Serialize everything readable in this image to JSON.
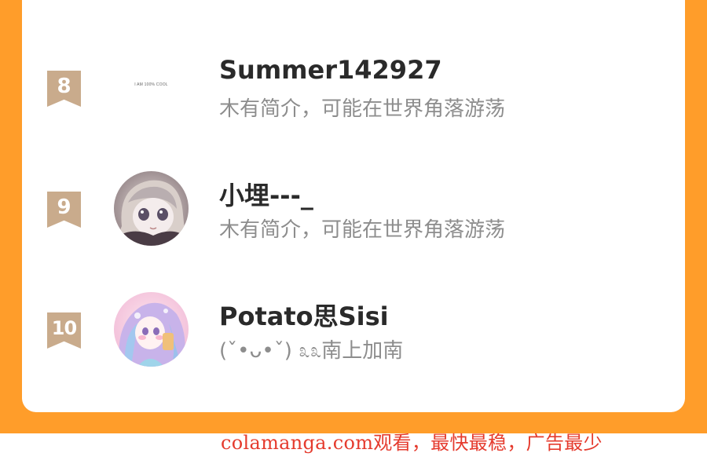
{
  "ranking": {
    "entries": [
      {
        "rank": "8",
        "username": "Summer142927",
        "bio": "木有简介，可能在世界角落游荡",
        "avatar_text": "I AM 100% COOL"
      },
      {
        "rank": "9",
        "username": "小埋---_",
        "bio": "木有简介，可能在世界角落游荡"
      },
      {
        "rank": "10",
        "username": "Potato思Sisi",
        "bio": "(ˇ•ᴗ•ˇ) ೩೩南上加南"
      }
    ]
  },
  "watermark": "colamanga.com观看，最快最稳，广告最少",
  "colors": {
    "background_orange": "#ff9d2a",
    "badge": "#c9ab8c",
    "watermark": "#e53b2e"
  }
}
